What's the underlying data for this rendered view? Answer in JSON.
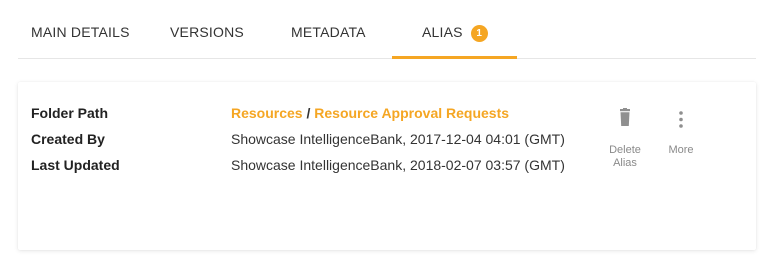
{
  "theme": {
    "accent": "#f5a623"
  },
  "tabs": [
    {
      "label": "MAIN DETAILS",
      "active": false
    },
    {
      "label": "VERSIONS",
      "active": false
    },
    {
      "label": "METADATA",
      "active": false
    },
    {
      "label": "ALIAS",
      "active": true,
      "badge": "1"
    }
  ],
  "details": {
    "folder_path_label": "Folder Path",
    "created_by_label": "Created By",
    "last_updated_label": "Last Updated",
    "folder_path": {
      "parent": "Resources",
      "separator": "/",
      "child": "Resource Approval Requests"
    },
    "created_by": "Showcase IntelligenceBank, 2017-12-04 04:01 (GMT)",
    "last_updated": "Showcase IntelligenceBank, 2018-02-07 03:57 (GMT)"
  },
  "actions": {
    "delete": {
      "label_line1": "Delete",
      "label_line2": "Alias",
      "icon": "trash-icon"
    },
    "more": {
      "label": "More",
      "icon": "more-vertical-icon"
    }
  }
}
